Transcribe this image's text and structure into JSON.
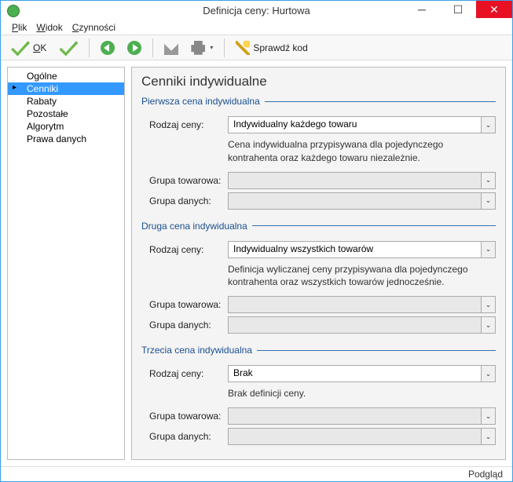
{
  "window": {
    "title": "Definicja ceny: Hurtowa"
  },
  "menu": {
    "plik": "Plik",
    "widok": "Widok",
    "czynnosci": "Czynności"
  },
  "toolbar": {
    "ok": "OK",
    "sprawdz": "Sprawdź kod"
  },
  "sidebar": {
    "items": [
      {
        "label": "Ogólne"
      },
      {
        "label": "Cenniki"
      },
      {
        "label": "Rabaty"
      },
      {
        "label": "Pozostałe"
      },
      {
        "label": "Algorytm"
      },
      {
        "label": "Prawa danych"
      }
    ],
    "selected_index": 1
  },
  "main": {
    "title": "Cenniki indywidualne",
    "sections": [
      {
        "legend": "Pierwsza cena indywidualna",
        "rodzaj_label": "Rodzaj ceny:",
        "rodzaj_value": "Indywidualny każdego towaru",
        "desc": "Cena indywidualna przypisywana dla pojedynczego kontrahenta oraz każdego towaru niezależnie.",
        "grupa_tow_label": "Grupa towarowa:",
        "grupa_tow_value": "",
        "grupa_dan_label": "Grupa danych:",
        "grupa_dan_value": ""
      },
      {
        "legend": "Druga cena indywidualna",
        "rodzaj_label": "Rodzaj ceny:",
        "rodzaj_value": "Indywidualny wszystkich towarów",
        "desc": "Definicja wyliczanej ceny przypisywana dla pojedynczego kontrahenta oraz wszystkich towarów jednocześnie.",
        "grupa_tow_label": "Grupa towarowa:",
        "grupa_tow_value": "",
        "grupa_dan_label": "Grupa danych:",
        "grupa_dan_value": ""
      },
      {
        "legend": "Trzecia cena indywidualna",
        "rodzaj_label": "Rodzaj ceny:",
        "rodzaj_value": "Brak",
        "desc": "Brak definicji ceny.",
        "grupa_tow_label": "Grupa towarowa:",
        "grupa_tow_value": "",
        "grupa_dan_label": "Grupa danych:",
        "grupa_dan_value": ""
      }
    ]
  },
  "status": {
    "text": "Podgląd"
  }
}
